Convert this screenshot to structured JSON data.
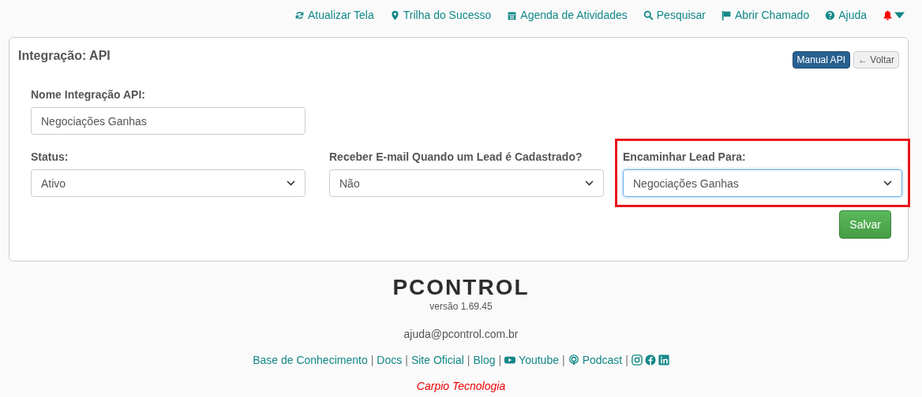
{
  "top_nav": [
    {
      "label": "Atualizar Tela"
    },
    {
      "label": "Trilha do Sucesso"
    },
    {
      "label": "Agenda de Atividades"
    },
    {
      "label": "Pesquisar"
    },
    {
      "label": "Abrir Chamado"
    },
    {
      "label": "Ajuda"
    }
  ],
  "card": {
    "title": "Integração: API",
    "buttons": [
      {
        "kind": "primary",
        "label": "Manual API"
      },
      {
        "kind": "back",
        "arrow": "←",
        "label": "Voltar"
      }
    ],
    "name_field": {
      "label": "Nome Integração API:",
      "value": "Negociações Ganhas"
    },
    "selects": [
      {
        "label": "Status:",
        "value": "Ativo",
        "highlighted": false
      },
      {
        "label": "Receber E-mail Quando um Lead é Cadastrado?",
        "value": "Não",
        "highlighted": false
      },
      {
        "label": "Encaminhar Lead Para:",
        "value": "Negociações Ganhas",
        "highlighted": true
      }
    ],
    "save_button": "Salvar"
  },
  "footer": {
    "logo": "PCONTROL",
    "version": "versão 1.69.45",
    "email": "ajuda@pcontrol.com.br",
    "links": [
      {
        "kind": "text",
        "label": "Base de Conhecimento"
      },
      {
        "kind": "separator",
        "label": "|"
      },
      {
        "kind": "text",
        "label": "Docs"
      },
      {
        "kind": "separator",
        "label": "|"
      },
      {
        "kind": "text",
        "label": "Site Oficial"
      },
      {
        "kind": "separator",
        "label": "|"
      },
      {
        "kind": "text",
        "label": "Blog"
      },
      {
        "kind": "separator",
        "label": "|"
      },
      {
        "kind": "youtube",
        "label": "Youtube"
      },
      {
        "kind": "separator",
        "label": "|"
      },
      {
        "kind": "podcast",
        "label": "Podcast"
      },
      {
        "kind": "separator",
        "label": "|"
      },
      {
        "kind": "instagram"
      },
      {
        "kind": "facebook"
      },
      {
        "kind": "linkedin"
      }
    ],
    "company": "Carpio Tecnologia"
  }
}
